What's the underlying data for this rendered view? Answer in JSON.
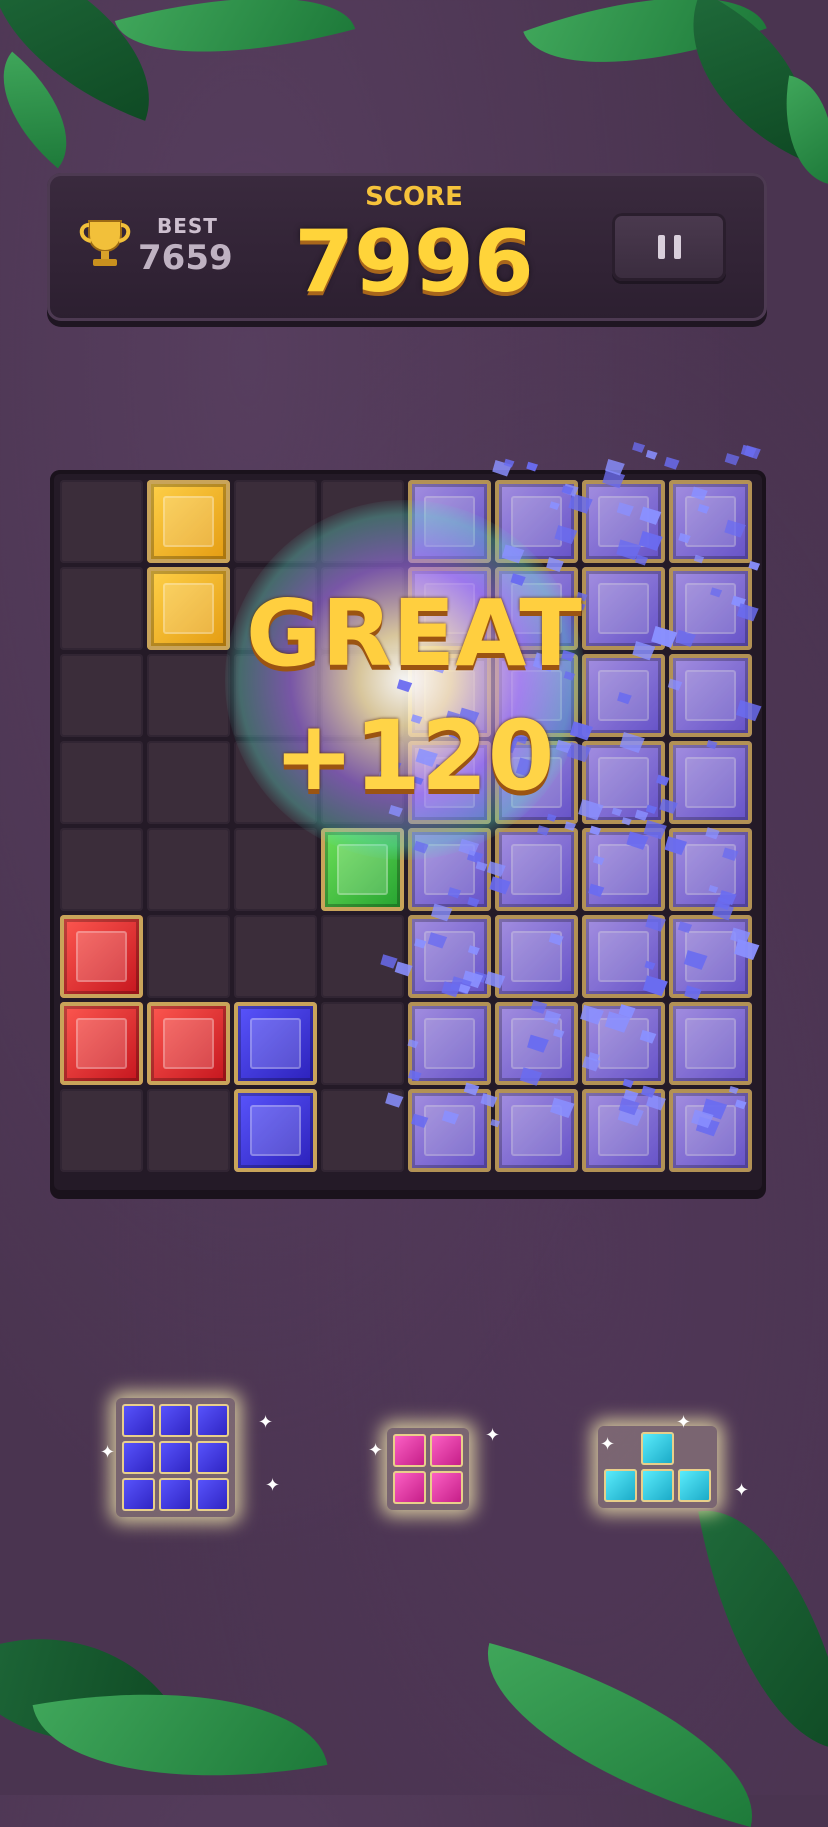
{
  "hud": {
    "best_label": "BEST",
    "best_value": "7659",
    "score_label": "SCORE",
    "score_value": "7996",
    "trophy_icon": "trophy-icon",
    "pause_icon": "pause-icon"
  },
  "combo": {
    "word": "GREAT",
    "points": "+120"
  },
  "colors": {
    "background": "#4a3450",
    "score_text": "#ffd43a",
    "gem_yellow": "#f4b62a",
    "gem_red": "#e8302f",
    "gem_blue": "#3b33e0",
    "gem_green": "#3fc44a",
    "gem_pink": "#e83aa8",
    "gem_cyan": "#2ec9e8"
  },
  "board": {
    "size": 8,
    "filled": [
      {
        "row": 0,
        "col": 1,
        "color": "yellow"
      },
      {
        "row": 1,
        "col": 1,
        "color": "yellow"
      },
      {
        "row": 4,
        "col": 3,
        "color": "green"
      },
      {
        "row": 5,
        "col": 0,
        "color": "red"
      },
      {
        "row": 6,
        "col": 0,
        "color": "red"
      },
      {
        "row": 6,
        "col": 1,
        "color": "red"
      },
      {
        "row": 6,
        "col": 2,
        "color": "blue"
      },
      {
        "row": 7,
        "col": 2,
        "color": "blue"
      }
    ]
  },
  "tray": [
    {
      "shape": "3x3 square",
      "color": "blue"
    },
    {
      "shape": "2x2 square",
      "color": "pink"
    },
    {
      "shape": "T",
      "color": "cyan"
    }
  ]
}
